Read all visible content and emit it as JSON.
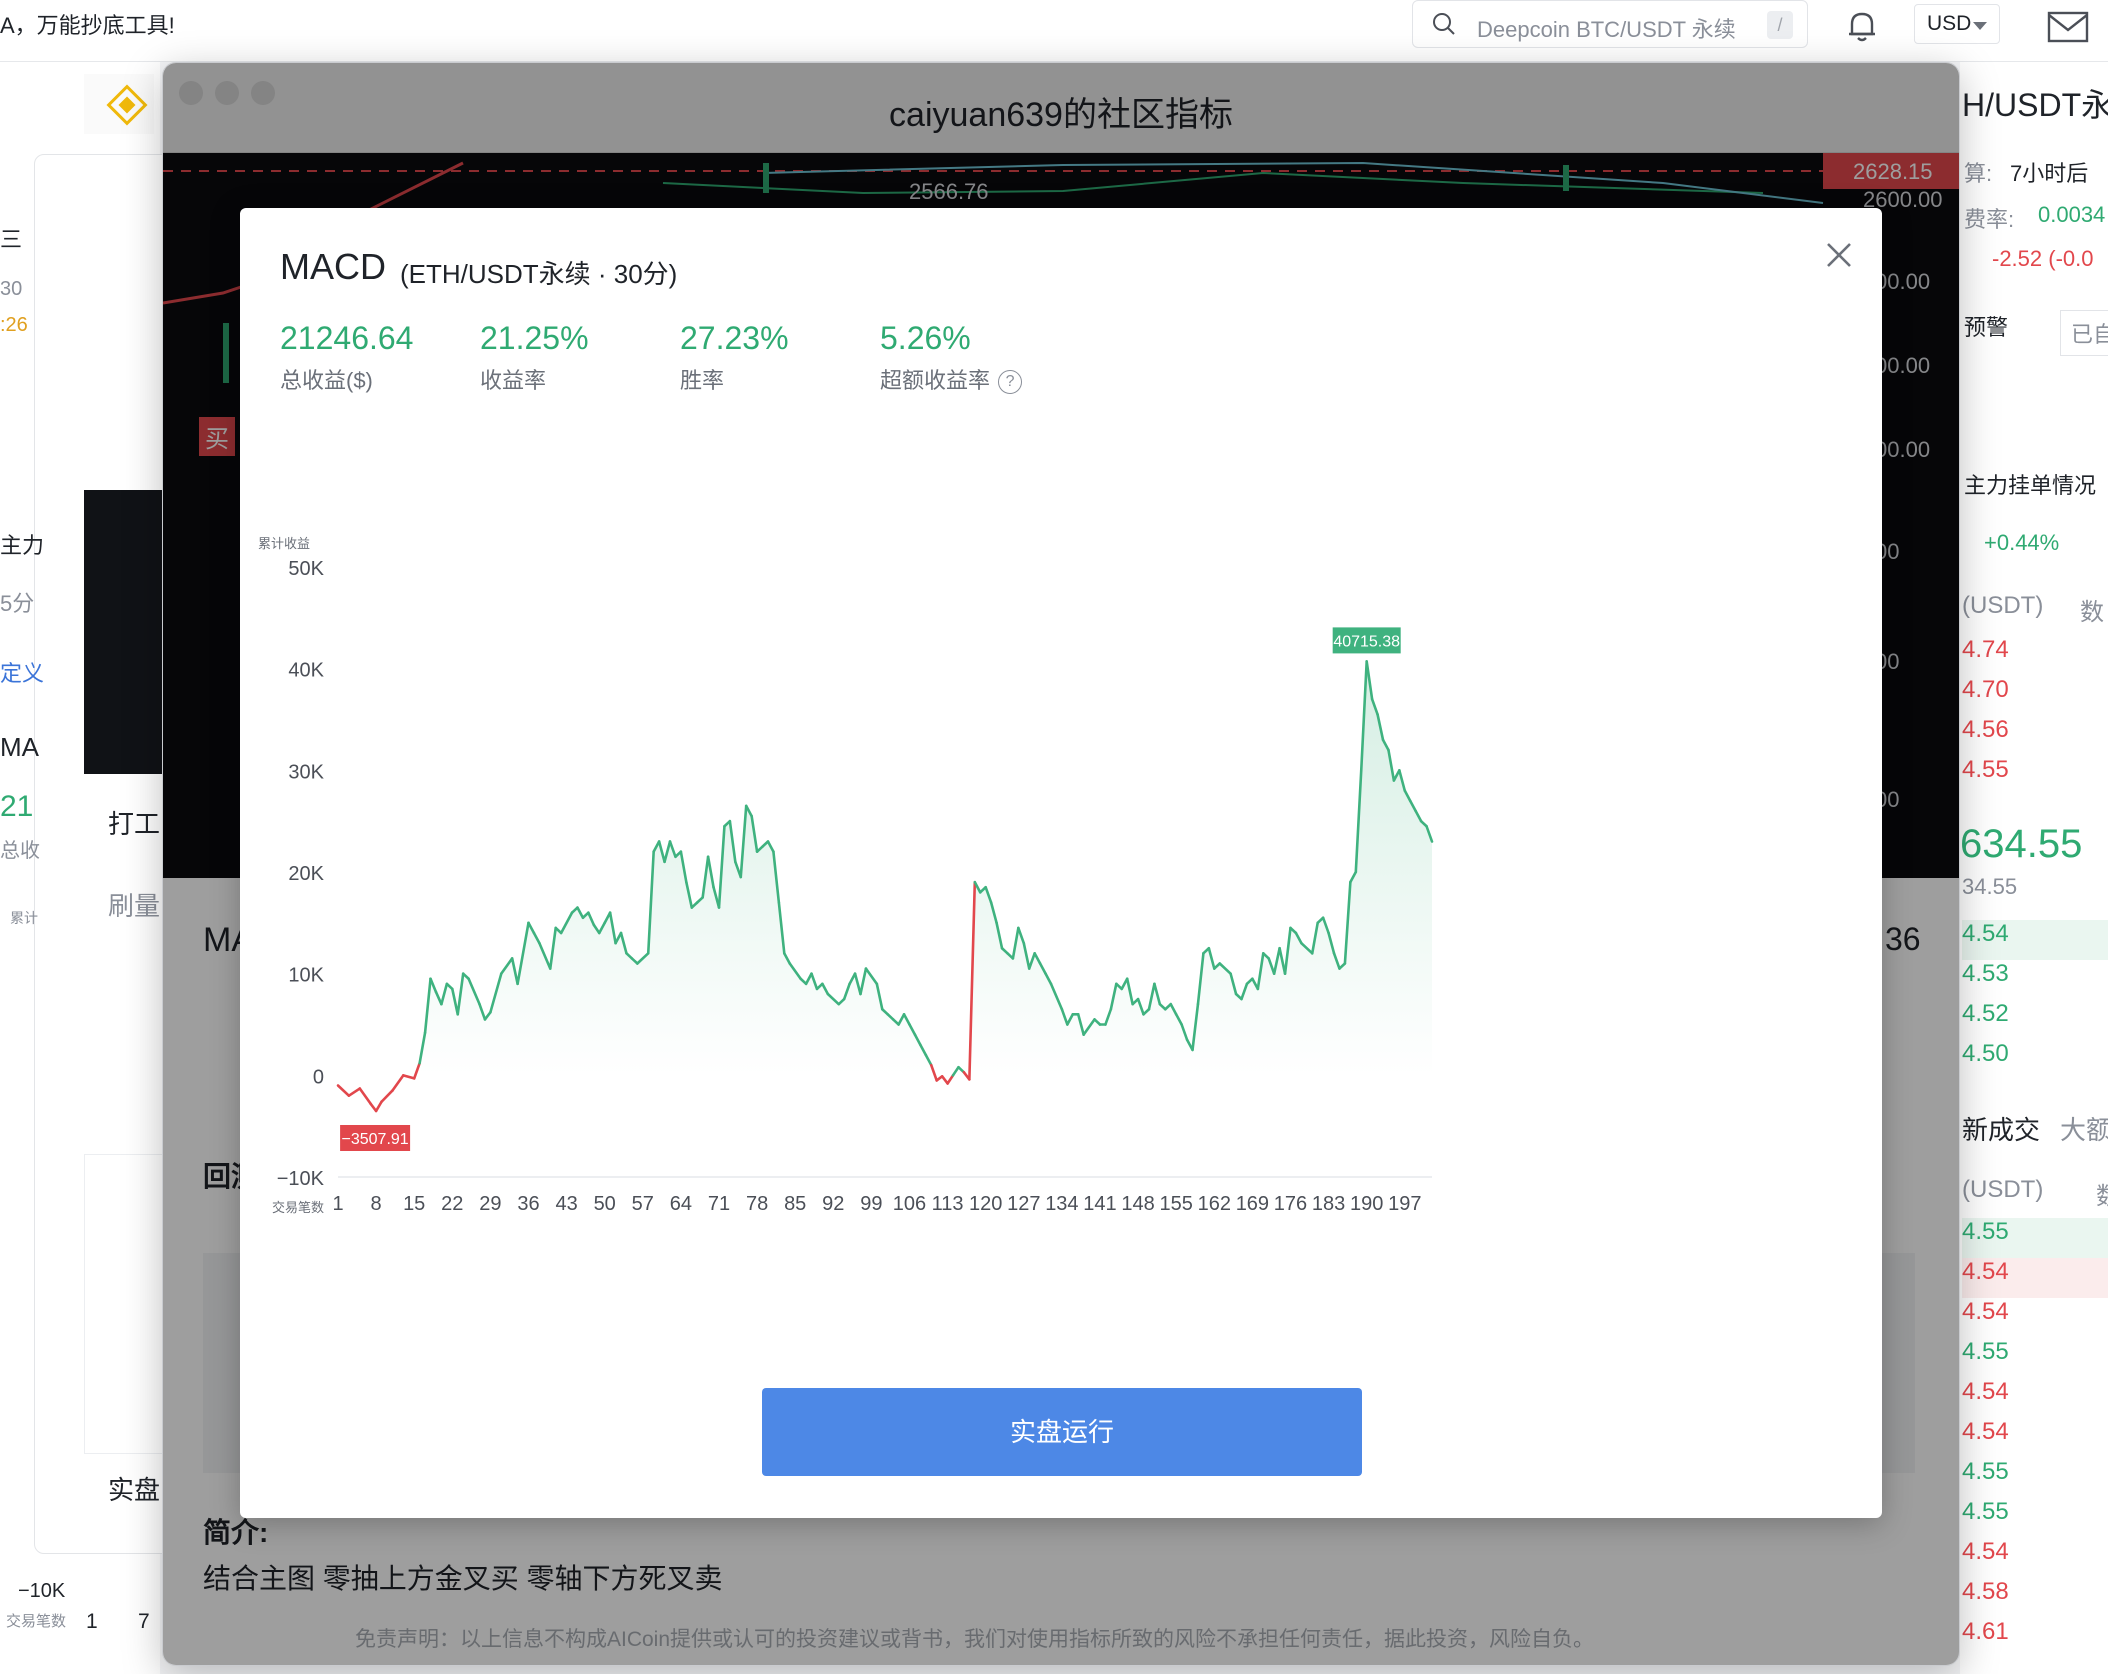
{
  "topbar": {
    "banner": "A，万能抄底工具!",
    "search_placeholder": "Deepcoin BTC/USDT 永续",
    "search_shortcut": "/",
    "currency": "USD"
  },
  "left_panel": {
    "items": [
      "三",
      "30",
      ":26",
      "主力",
      "5分",
      "定义",
      "MA",
      "21",
      "总收",
      "累计",
      "打工",
      "刷量",
      "实盘",
      "−10K",
      "交易笔数",
      "1",
      "7"
    ]
  },
  "right_panel": {
    "pair_title": "H/USDT永续",
    "settle_label": "算:",
    "settle_value": "7小时后",
    "fee_label": "费率:",
    "fee_value": "0.0034",
    "change_value": "-2.52 (-0.0",
    "alert_button": "预警",
    "added_button": "已自选",
    "orderbook_title": "主力挂单情况",
    "orderbook_change": "+0.44%",
    "col_price": "(USDT)",
    "col_amount": "数",
    "ask_prices": [
      "4.74",
      "4.70",
      "4.56",
      "4.55"
    ],
    "last_price": "634.55",
    "last_sub": "34.55",
    "bid_prices": [
      "4.54",
      "4.53",
      "4.52",
      "4.50"
    ],
    "tab_latest": "新成交",
    "tab_large": "大额",
    "trades_col_price": "(USDT)",
    "trades_col_amount": "数",
    "trade_prices": [
      "4.55",
      "4.54",
      "4.54",
      "4.55",
      "4.54",
      "4.54",
      "4.55",
      "4.55",
      "4.54",
      "4.58",
      "4.61"
    ]
  },
  "community_window": {
    "title": "caiyuan639的社区指标",
    "price_line_label": "2628.15",
    "price_ref_label": "2566.76",
    "axis_labels": [
      "2600.00",
      "00.00",
      "00.00",
      "00.00",
      "00",
      "00",
      "00"
    ],
    "buy_marker": "买",
    "section_title": "MA",
    "backtest_label": "回测",
    "right_number": "36",
    "intro_title": "简介:",
    "intro_text": "结合主图 零抽上方金叉买 零轴下方死叉卖",
    "disclaimer": "免责声明：以上信息不构成AICoin提供或认可的投资建议或背书，我们对使用指标所致的风险不承担任何责任，据此投资，风险自负。"
  },
  "modal": {
    "title": "MACD",
    "subtitle": "(ETH/USDT永续 · 30分)",
    "stats": [
      {
        "value": "21246.64",
        "label": "总收益($)"
      },
      {
        "value": "21.25%",
        "label": "收益率"
      },
      {
        "value": "27.23%",
        "label": "胜率"
      },
      {
        "value": "5.26%",
        "label": "超额收益率"
      }
    ],
    "help_icon": "?",
    "run_button": "实盘运行"
  },
  "chart_data": {
    "type": "area",
    "ylabel": "累计收益",
    "xlabel": "交易笔数",
    "ylim": [
      -10000,
      50000
    ],
    "y_ticks": [
      "50K",
      "40K",
      "30K",
      "20K",
      "10K",
      "0",
      "−10K"
    ],
    "x_ticks": [
      "1",
      "8",
      "15",
      "22",
      "29",
      "36",
      "43",
      "50",
      "57",
      "64",
      "71",
      "78",
      "85",
      "92",
      "99",
      "106",
      "113",
      "120",
      "127",
      "134",
      "141",
      "148",
      "155",
      "162",
      "169",
      "176",
      "183",
      "190",
      "197"
    ],
    "max_label": "40715.38",
    "min_label": "−3507.91",
    "colors": {
      "positive": "#3fb27f",
      "negative": "#e2474c"
    },
    "x": [
      1,
      3,
      5,
      7,
      8,
      9,
      11,
      13,
      15,
      16,
      17,
      18,
      19,
      20,
      21,
      22,
      23,
      24,
      25,
      27,
      28,
      29,
      31,
      33,
      34,
      36,
      37,
      38,
      40,
      41,
      42,
      44,
      45,
      46,
      47,
      48,
      49,
      50,
      51,
      52,
      53,
      54,
      55,
      56,
      58,
      59,
      60,
      61,
      62,
      63,
      64,
      65,
      66,
      67,
      68,
      69,
      70,
      71,
      72,
      73,
      74,
      75,
      76,
      77,
      78,
      79,
      80,
      81,
      82,
      83,
      84,
      86,
      87,
      88,
      89,
      90,
      91,
      93,
      94,
      95,
      96,
      97,
      98,
      100,
      101,
      102,
      103,
      104,
      105,
      106,
      107,
      108,
      109,
      110,
      111,
      112,
      113,
      114,
      115,
      116,
      117,
      118,
      119,
      120,
      121,
      122,
      123,
      124,
      125,
      126,
      127,
      128,
      129,
      130,
      131,
      132,
      134,
      135,
      136,
      137,
      138,
      140,
      141,
      142,
      143,
      144,
      145,
      146,
      147,
      148,
      149,
      150,
      151,
      152,
      153,
      154,
      155,
      156,
      157,
      158,
      159,
      160,
      161,
      162,
      163,
      165,
      166,
      167,
      168,
      169,
      170,
      171,
      172,
      173,
      174,
      175,
      176,
      177,
      178,
      180,
      181,
      182,
      183,
      184,
      185,
      186,
      187,
      188,
      189,
      190,
      191,
      192,
      193,
      194,
      195,
      196,
      197,
      198,
      199,
      200,
      201,
      202
    ],
    "y": [
      -1000,
      -2000,
      -1300,
      -2800,
      -3508,
      -2600,
      -1500,
      0,
      -300,
      1200,
      4200,
      9500,
      8200,
      7000,
      9000,
      8500,
      6000,
      10000,
      9500,
      7000,
      5500,
      6200,
      10000,
      11500,
      9000,
      15000,
      14000,
      13000,
      10500,
      14500,
      14000,
      16000,
      16500,
      15500,
      16000,
      14800,
      14000,
      15000,
      16000,
      13000,
      14000,
      12000,
      11500,
      11000,
      12000,
      22000,
      23000,
      21000,
      23000,
      21500,
      22000,
      19000,
      16500,
      17000,
      17500,
      21500,
      18500,
      16500,
      24500,
      25000,
      21000,
      19500,
      26500,
      25500,
      22000,
      22500,
      23000,
      22000,
      17000,
      12000,
      11000,
      9500,
      9000,
      10000,
      8500,
      9000,
      8000,
      7000,
      7500,
      9000,
      10000,
      8000,
      10500,
      9000,
      6500,
      6000,
      5500,
      5000,
      6000,
      5000,
      4000,
      3000,
      2000,
      1000,
      -500,
      -100,
      -800,
      0,
      800,
      300,
      -400,
      19000,
      18000,
      18500,
      17000,
      15000,
      12500,
      12000,
      11500,
      14500,
      13000,
      10500,
      12000,
      11000,
      10000,
      9000,
      6500,
      5000,
      6000,
      6000,
      4000,
      5500,
      5000,
      5000,
      6500,
      9000,
      8500,
      9500,
      7000,
      7500,
      6000,
      6500,
      9000,
      7000,
      6500,
      7000,
      6000,
      5000,
      3500,
      2500,
      7000,
      12000,
      12500,
      10500,
      11000,
      10000,
      8000,
      7500,
      9000,
      9500,
      8500,
      12000,
      11500,
      10000,
      12500,
      10000,
      14500,
      14000,
      13000,
      12000,
      15000,
      15500,
      14000,
      12000,
      10500,
      11000,
      19000,
      20000,
      30000,
      40715,
      37000,
      35500,
      33000,
      32000,
      29000,
      30000,
      28000,
      27000,
      26000,
      25000,
      24500,
      23000,
      22500,
      21500,
      21000,
      20000,
      21000,
      18000,
      16000
    ]
  }
}
